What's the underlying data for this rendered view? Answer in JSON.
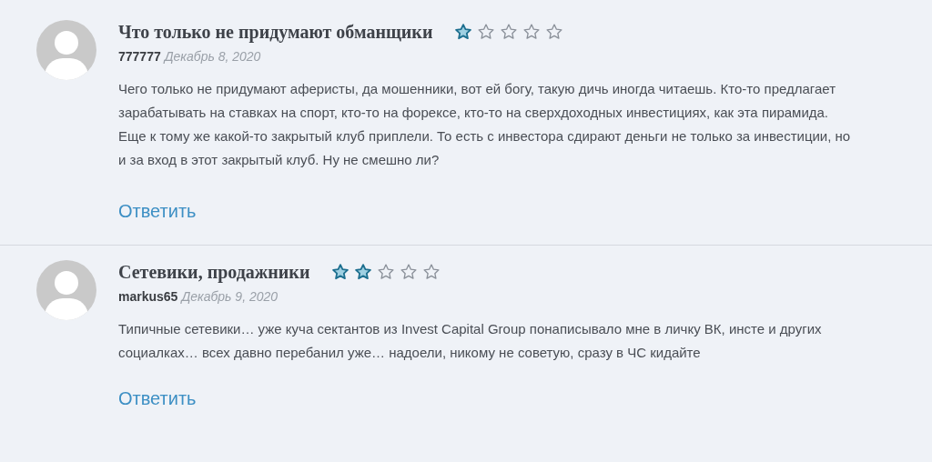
{
  "comments": [
    {
      "title": "Что только не придумают обманщики",
      "stars": 1,
      "author": "777777",
      "date": "Декабрь 8, 2020",
      "text": "Чего только не придумают аферисты, да мошенники, вот ей богу, такую дичь иногда читаешь. Кто-то предлагает зарабатывать на ставках на спорт, кто-то на форексе, кто-то на сверхдоходных инвестициях, как эта пирамида. Еще к тому же какой-то закрытый клуб приплели. То есть с инвестора сдирают деньги не только за инвестиции, но и за вход в этот закрытый клуб. Ну не смешно ли?",
      "reply": "Ответить"
    },
    {
      "title": "Сетевики, продажники",
      "stars": 2,
      "author": "markus65",
      "date": "Декабрь 9, 2020",
      "text": "Типичные сетевики… уже куча сектантов из Invest Capital Group понаписывало мне в личку ВК, инсте и других социалках… всех давно перебанил уже… надоели, никому не советую, сразу в ЧС кидайте",
      "reply": "Ответить"
    }
  ]
}
